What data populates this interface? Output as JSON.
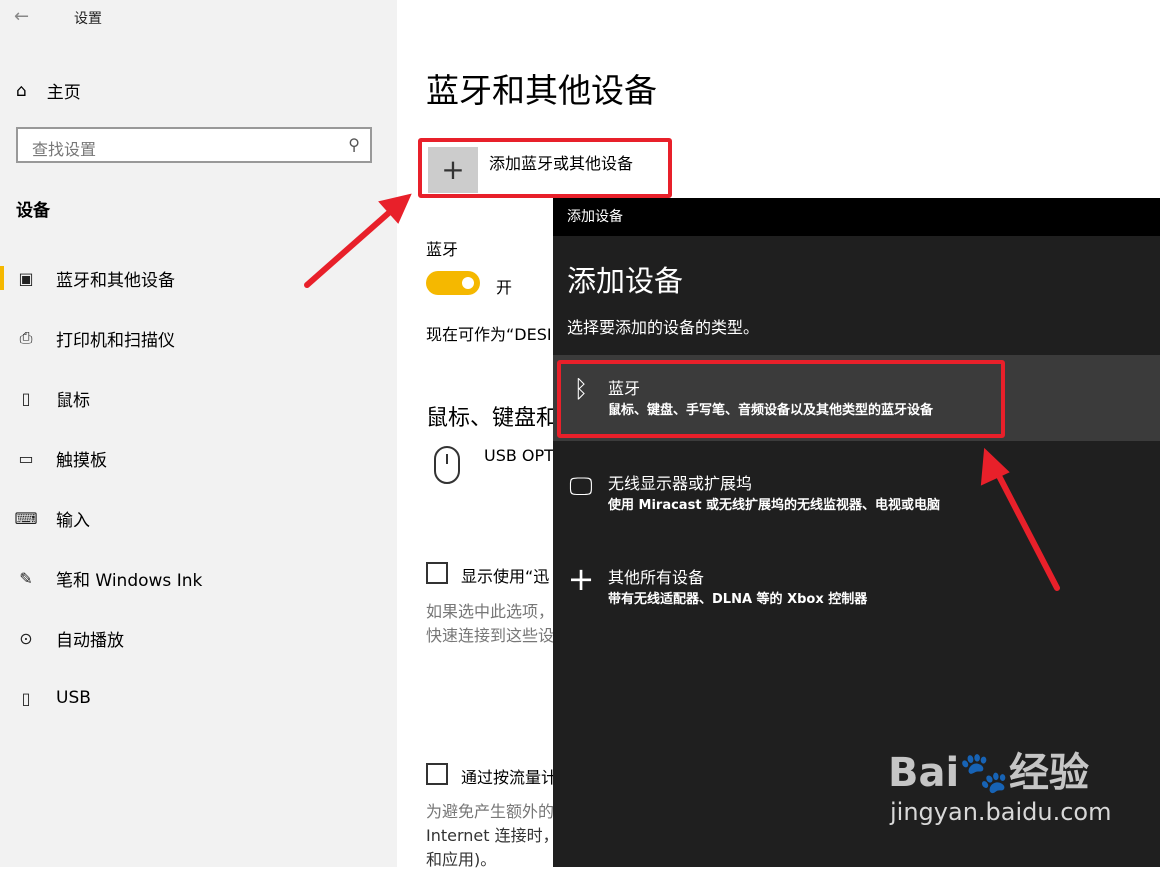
{
  "window": {
    "title": "设置",
    "back_icon": "back-arrow-icon"
  },
  "sidebar": {
    "home_label": "主页",
    "search_placeholder": "查找设置",
    "section_label": "设备",
    "items": [
      {
        "label": "蓝牙和其他设备",
        "icon": "bluetooth-devices-icon",
        "active": true
      },
      {
        "label": "打印机和扫描仪",
        "icon": "printer-icon"
      },
      {
        "label": "鼠标",
        "icon": "mouse-icon"
      },
      {
        "label": "触摸板",
        "icon": "touchpad-icon"
      },
      {
        "label": "输入",
        "icon": "keyboard-icon"
      },
      {
        "label": "笔和 Windows Ink",
        "icon": "pen-icon"
      },
      {
        "label": "自动播放",
        "icon": "autoplay-icon"
      },
      {
        "label": "USB",
        "icon": "usb-icon"
      }
    ]
  },
  "main": {
    "title": "蓝牙和其他设备",
    "add_device_label": "添加蓝牙或其他设备",
    "bluetooth_heading": "蓝牙",
    "bluetooth_toggle_label": "开",
    "discoverable_text": "现在可作为“DESI",
    "mk_heading": "鼠标、键盘和",
    "usb_device": "USB OPTI",
    "checkbox1_label": "显示使用“迅",
    "hint1_line1": "如果选中此选项，",
    "hint1_line2": "快速连接到这些设",
    "checkbox2_label": "通过按流量计",
    "hint2_line1": "为避免产生额外的",
    "hint2_line2": "Internet 连接时，",
    "hint2_line3": "和应用)。"
  },
  "dialog": {
    "titlebar": "添加设备",
    "title": "添加设备",
    "subtitle": "选择要添加的设备的类型。",
    "options": [
      {
        "name": "蓝牙",
        "desc": "鼠标、键盘、手写笔、音频设备以及其他类型的蓝牙设备",
        "icon": "bluetooth-icon",
        "selected": true
      },
      {
        "name": "无线显示器或扩展坞",
        "desc": "使用 Miracast 或无线扩展坞的无线监视器、电视或电脑",
        "icon": "monitor-icon"
      },
      {
        "name": "其他所有设备",
        "desc": "带有无线适配器、DLNA 等的 Xbox 控制器",
        "icon": "plus-icon"
      }
    ]
  },
  "watermark": {
    "logo": "Bai🐾经验",
    "url": "jingyan.baidu.com"
  },
  "colors": {
    "accent": "#f5b800",
    "highlight_red": "#e8202a",
    "dialog_bg": "#1f1f1f",
    "sidebar_bg": "#f2f2f2"
  }
}
